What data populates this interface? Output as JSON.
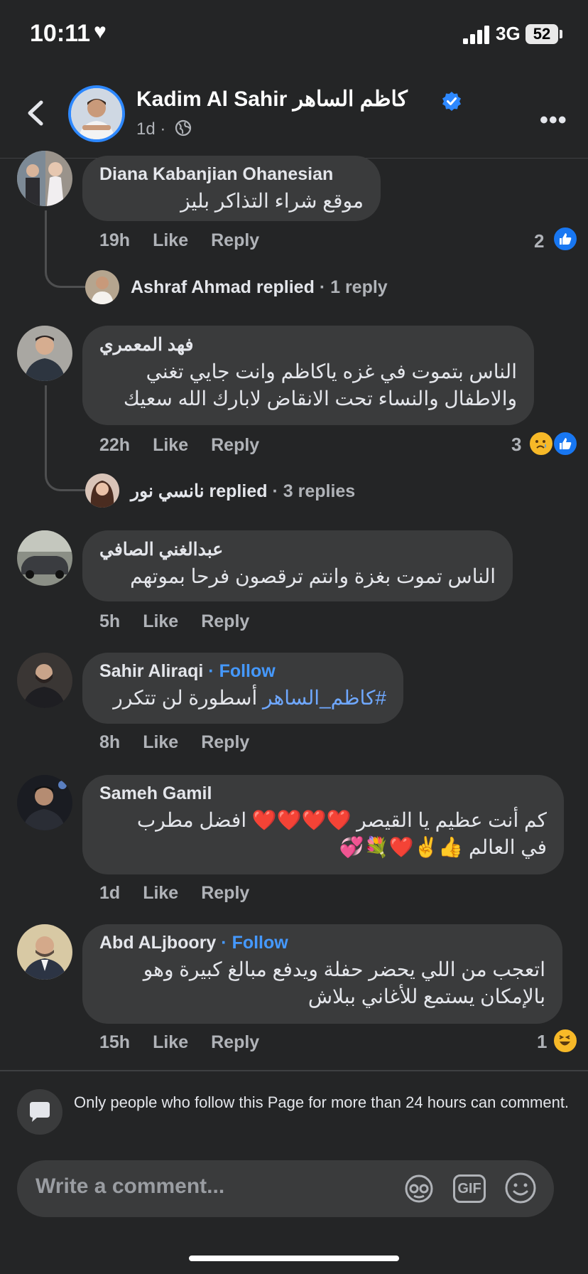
{
  "status_bar": {
    "time": "10:11",
    "network": "3G",
    "battery": "52"
  },
  "header": {
    "page_name": "Kadim Al Sahir كاظم الساهر",
    "age": "1d ·"
  },
  "comments": [
    {
      "author": "Diana Kabanjian Ohanesian",
      "text": "موقع شراء التذاكر بليز",
      "time": "19h",
      "like": "Like",
      "reply": "Reply",
      "reaction_count": "2"
    },
    {
      "author": "فهد المعمري",
      "text_line1": "الناس بتموت في غزه ياكاظم وانت جايي تغني",
      "text_line2": "والاطفال والنساء تحت الانقاض لابارك الله سعيك",
      "time": "22h",
      "like": "Like",
      "reply": "Reply",
      "reaction_count": "3"
    },
    {
      "author": "عبدالغني الصافي",
      "text": "الناس تموت بغزة وانتم ترقصون فرحا بموتهم",
      "time": "5h",
      "like": "Like",
      "reply": "Reply"
    },
    {
      "author": "Sahir Aliraqi",
      "follow": "· Follow",
      "hashtag": "#كاظم_الساهر",
      "text": "أسطورة لن تتكرر",
      "time": "8h",
      "like": "Like",
      "reply": "Reply"
    },
    {
      "author": "Sameh Gamil",
      "text_line1": "كم أنت عظيم يا القيصر ❤️❤️❤️❤️ افضل مطرب",
      "text_line2": "في العالم 👍✌️❤️💐💞",
      "time": "1d",
      "like": "Like",
      "reply": "Reply"
    },
    {
      "author": "Abd ALjboory",
      "follow": "· Follow",
      "text_line1": "اتعجب من اللي يحضر حفلة ويدفع مبالغ كبيرة وهو",
      "text_line2": "بالإمكان يستمع للأغاني ببلاش",
      "time": "15h",
      "like": "Like",
      "reply": "Reply",
      "reaction_count": "1"
    }
  ],
  "replies": [
    {
      "name": "Ashraf Ahmad",
      "verb": "replied",
      "count": "· 1 reply"
    },
    {
      "name": "نانسي نور",
      "verb": "replied",
      "count": "· 3 replies"
    }
  ],
  "notice": "Only people who follow this Page for more than 24 hours can comment.",
  "composer": {
    "placeholder": "Write a comment..."
  },
  "icons": {
    "accent": "#2d88ff",
    "like_reaction": "#1877f2",
    "follow": "#4599ff",
    "emoji_reaction": "#f7b928"
  }
}
